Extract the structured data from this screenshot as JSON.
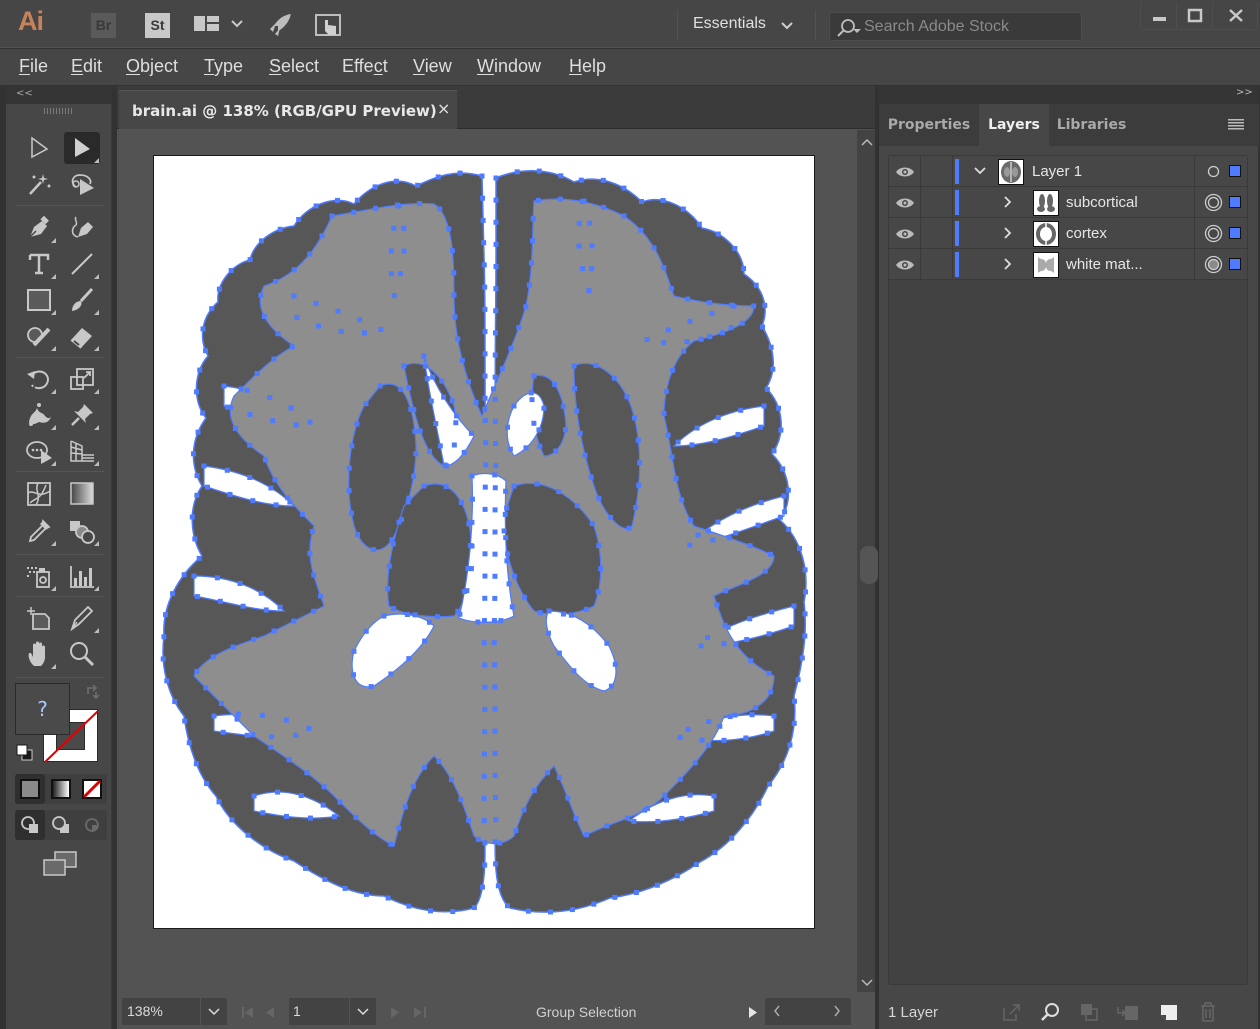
{
  "app": {
    "logo": "Ai",
    "bridge_badge": "Br",
    "stock_badge": "St",
    "workspace": "Essentials",
    "stock_search_placeholder": "Search Adobe Stock",
    "accent_color": "#4f7bff"
  },
  "menu": [
    {
      "label": "File",
      "mnemonic": "F"
    },
    {
      "label": "Edit",
      "mnemonic": "E"
    },
    {
      "label": "Object",
      "mnemonic": "O"
    },
    {
      "label": "Type",
      "mnemonic": "T"
    },
    {
      "label": "Select",
      "mnemonic": "S"
    },
    {
      "label": "Effect",
      "mnemonic": "c"
    },
    {
      "label": "View",
      "mnemonic": "V"
    },
    {
      "label": "Window",
      "mnemonic": "W"
    },
    {
      "label": "Help",
      "mnemonic": "H"
    }
  ],
  "tools_panel": {
    "collapse_label": "<<",
    "tools": [
      "selection-tool",
      "direct-selection-tool",
      "magic-wand-tool",
      "lasso-tool",
      "pen-tool",
      "curvature-tool",
      "type-tool",
      "line-segment-tool",
      "rectangle-tool",
      "paintbrush-tool",
      "shaper-tool",
      "eraser-tool",
      "rotate-tool",
      "scale-tool",
      "puppet-warp-tool",
      "pin-tool",
      "free-transform-tool",
      "perspective-grid-tool",
      "mesh-tool",
      "gradient-tool",
      "eyedropper-tool",
      "shape-builder-tool",
      "symbol-sprayer-tool",
      "column-graph-tool",
      "artboard-tool",
      "slice-tool",
      "hand-tool",
      "zoom-tool"
    ],
    "active_tool": "direct-selection-tool",
    "fill_label": "?"
  },
  "document": {
    "tab_title": "brain.ai @ 138% (RGB/GPU Preview)",
    "close_label": "×",
    "artwork_colors": {
      "cortex": "#575757",
      "white_matter": "#8e8e8e",
      "selection": "#4f7bff"
    }
  },
  "statusbar": {
    "zoom": "138%",
    "artboard_number": "1",
    "status_text": "Group Selection"
  },
  "right_panel": {
    "collapse_label": ">>",
    "tabs": [
      {
        "label": "Properties",
        "active": false
      },
      {
        "label": "Layers",
        "active": true
      },
      {
        "label": "Libraries",
        "active": false
      }
    ],
    "layers": [
      {
        "name": "Layer 1",
        "level": 0,
        "expanded": true,
        "visible": true
      },
      {
        "name": "subcortical",
        "level": 1,
        "expanded": false,
        "visible": true
      },
      {
        "name": "cortex",
        "level": 1,
        "expanded": false,
        "visible": true
      },
      {
        "name": "white mat...",
        "level": 1,
        "expanded": false,
        "visible": true
      }
    ],
    "footer_count": "1 Layer"
  }
}
